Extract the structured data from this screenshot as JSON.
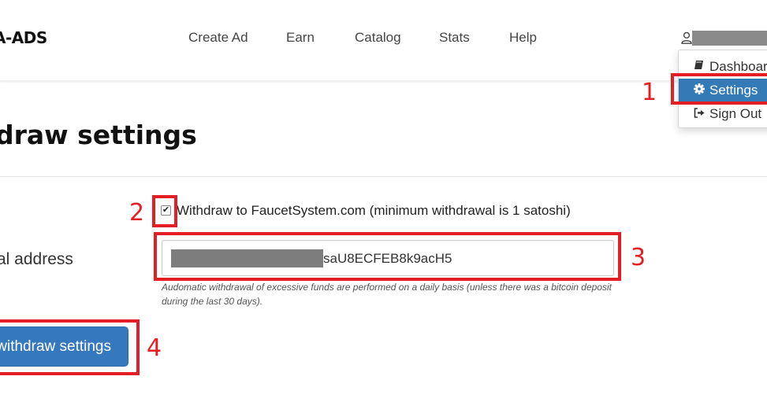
{
  "header": {
    "brand": "A-ADS",
    "nav": {
      "create_ad": "Create Ad",
      "earn": "Earn",
      "catalog": "Catalog",
      "stats": "Stats",
      "help": "Help"
    }
  },
  "user_menu": {
    "dashboard": "Dashboard",
    "settings": "Settings",
    "sign_out": "Sign Out"
  },
  "page": {
    "title": "draw settings",
    "withdraw_checkbox": {
      "checked": true,
      "label": "Withdraw to FaucetSystem.com (minimum withdrawal is 1 satoshi)"
    },
    "address": {
      "label": "al address",
      "value_visible": "saU8ECFEB8k9acH5",
      "help": "Audomatic withdrawal of excessive funds are performed on a daily basis (unless there was a bitcoin deposit during the last 30 days)."
    },
    "save_label": "withdraw settings"
  },
  "annotations": [
    "1",
    "2",
    "3",
    "4"
  ],
  "colors": {
    "accent": "#337ab7",
    "button": "#3578bd",
    "annotation": "#e31e24"
  }
}
